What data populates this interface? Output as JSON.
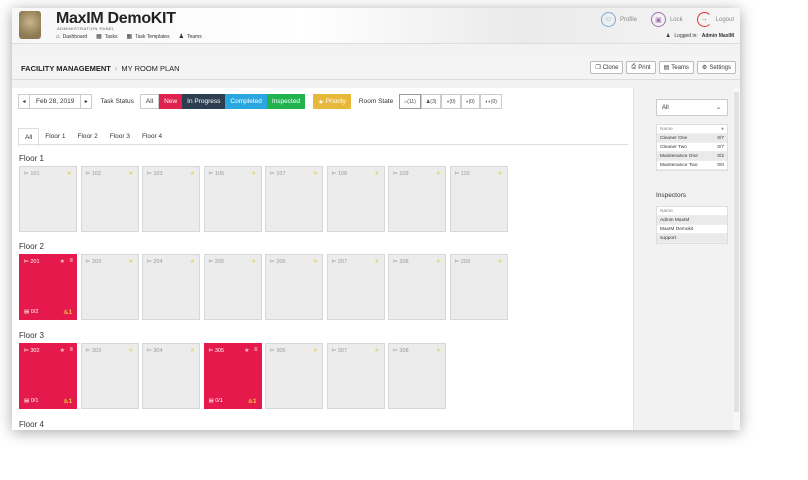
{
  "header": {
    "brand": "MaxIM DemoKIT",
    "brand_sub": "ADMINISTRATION PANEL",
    "nav": [
      "Dashboard",
      "Tasks",
      "Task Templates",
      "Teams"
    ],
    "profile": "Profile",
    "lock": "Lock",
    "logout": "Logout",
    "logged_in_label": "Logged in:",
    "logged_in_user": "Admin MaxIM"
  },
  "titlebar": {
    "section": "FACILITY MANAGEMENT",
    "separator": "›",
    "page": "MY ROOM PLAN",
    "buttons": [
      "Clone",
      "Print",
      "Teams",
      "Settings"
    ]
  },
  "toolbar": {
    "date": "Feb 28, 2019",
    "task_status_label": "Task Status",
    "statuses": [
      "All",
      "New",
      "In Progress",
      "Completed",
      "Inspected"
    ],
    "priority": "Priority",
    "room_state_label": "Room State",
    "room_states": [
      "(11)",
      "(3)",
      "(0)",
      "(0)",
      "(0)"
    ]
  },
  "tabs": [
    "All",
    "Floor 1",
    "Floor 2",
    "Floor 3",
    "Floor 4"
  ],
  "floors": [
    {
      "title": "Floor 1",
      "rooms": [
        {
          "num": "101",
          "alert": false
        },
        {
          "num": "102",
          "alert": false
        },
        {
          "num": "103",
          "alert": false
        },
        {
          "num": "105",
          "alert": false
        },
        {
          "num": "107",
          "alert": false
        },
        {
          "num": "108",
          "alert": false
        },
        {
          "num": "109",
          "alert": false
        },
        {
          "num": "110",
          "alert": false
        }
      ]
    },
    {
      "title": "Floor 2",
      "rooms": [
        {
          "num": "201",
          "alert": true,
          "count": "0/2",
          "bell": "1"
        },
        {
          "num": "203",
          "alert": false
        },
        {
          "num": "204",
          "alert": false
        },
        {
          "num": "205",
          "alert": false
        },
        {
          "num": "206",
          "alert": false
        },
        {
          "num": "207",
          "alert": false
        },
        {
          "num": "208",
          "alert": false
        },
        {
          "num": "209",
          "alert": false
        }
      ]
    },
    {
      "title": "Floor 3",
      "rooms": [
        {
          "num": "302",
          "alert": true,
          "count": "0/1",
          "bell": "1"
        },
        {
          "num": "303",
          "alert": false
        },
        {
          "num": "304",
          "alert": false
        },
        {
          "num": "305",
          "alert": true,
          "count": "0/1",
          "bell": "1"
        },
        {
          "num": "306",
          "alert": false
        },
        {
          "num": "307",
          "alert": false
        },
        {
          "num": "308",
          "alert": false
        }
      ]
    },
    {
      "title": "Floor 4",
      "rooms": []
    }
  ],
  "side": {
    "filter": "All",
    "teams_header": [
      "Name",
      ""
    ],
    "teams": [
      {
        "name": "Cleaner One",
        "val": "0/7"
      },
      {
        "name": "Cleaner Two",
        "val": "0/7"
      },
      {
        "name": "Maintenance One",
        "val": "0/2"
      },
      {
        "name": "Maintenance Two",
        "val": "0/0"
      }
    ],
    "inspectors_title": "Inspectors",
    "inspectors_header": "Name",
    "inspectors": [
      "Admin MaxIM",
      "MaxIM Demokit",
      "support"
    ]
  },
  "colors": {
    "alert": "#e5194b",
    "new": "#e0224e",
    "in_progress": "#2c3e50",
    "completed": "#2aa6e0",
    "inspected": "#22b350",
    "priority": "#e8b83a"
  }
}
